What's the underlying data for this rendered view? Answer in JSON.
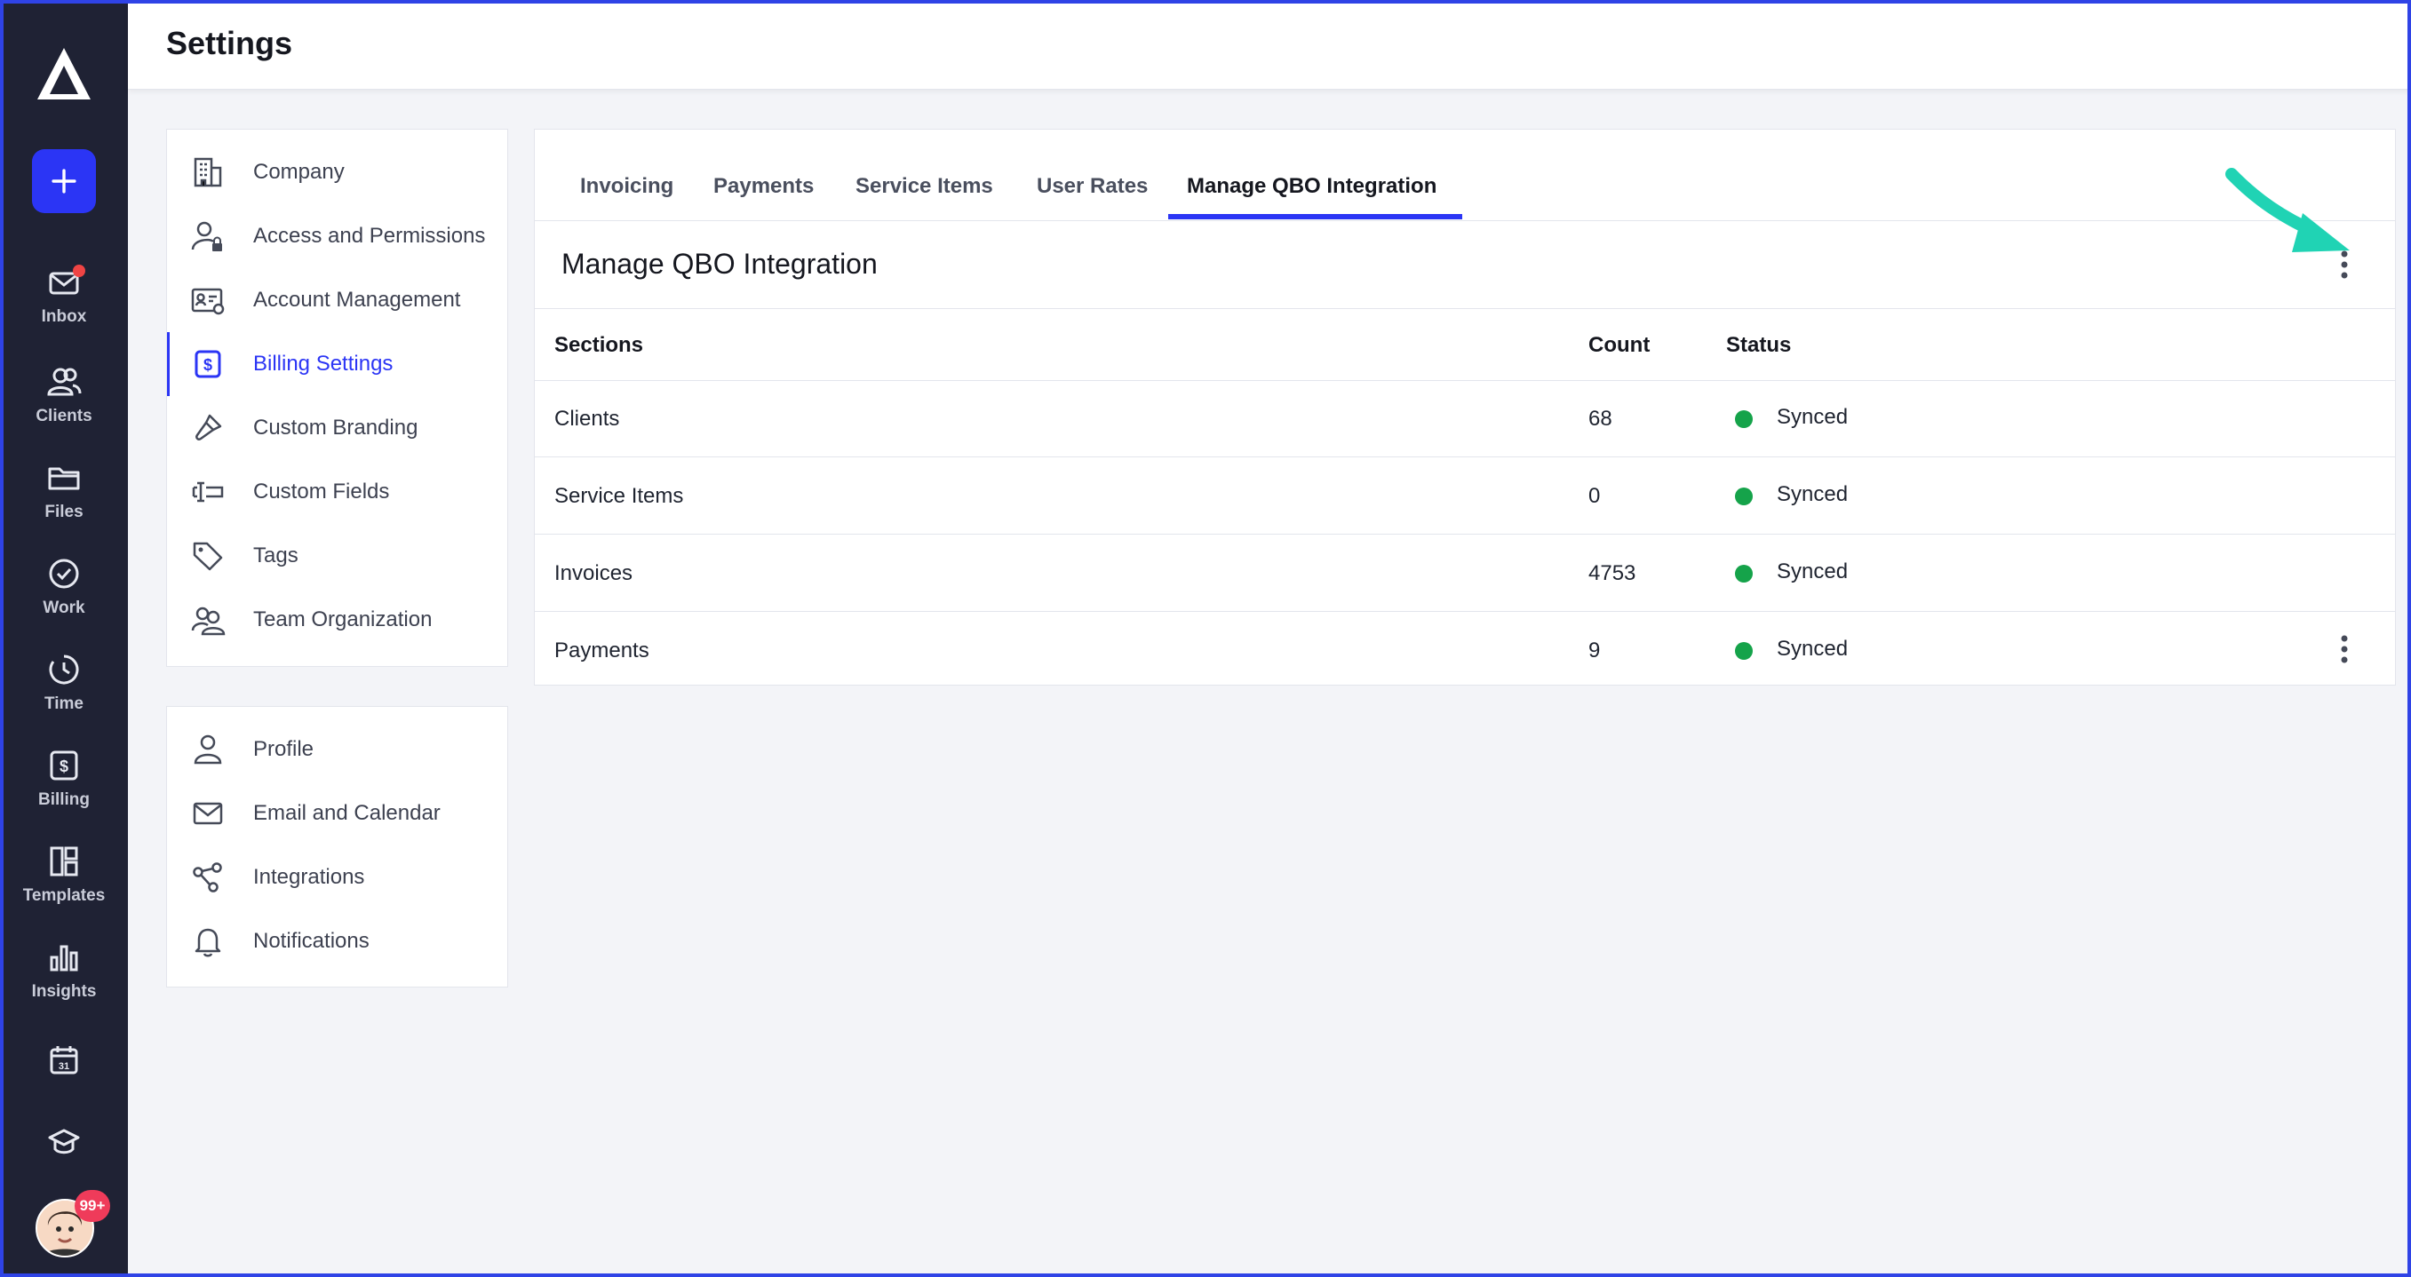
{
  "app": {
    "page_title": "Settings"
  },
  "rail": {
    "items": [
      {
        "label": "Inbox",
        "icon": "mail-icon"
      },
      {
        "label": "Clients",
        "icon": "users-icon"
      },
      {
        "label": "Files",
        "icon": "folder-icon"
      },
      {
        "label": "Work",
        "icon": "check-circle-icon"
      },
      {
        "label": "Time",
        "icon": "clock-icon"
      },
      {
        "label": "Billing",
        "icon": "dollar-square-icon"
      },
      {
        "label": "Templates",
        "icon": "templates-icon"
      },
      {
        "label": "Insights",
        "icon": "bar-chart-icon"
      }
    ],
    "avatar_badge": "99+",
    "calendar_day": "31"
  },
  "settings_nav": {
    "group1": [
      {
        "label": "Company",
        "icon": "building-icon"
      },
      {
        "label": "Access and Permissions",
        "icon": "user-lock-icon"
      },
      {
        "label": "Account Management",
        "icon": "id-card-gear-icon"
      },
      {
        "label": "Billing Settings",
        "icon": "dollar-square-icon",
        "active": true
      },
      {
        "label": "Custom Branding",
        "icon": "paint-brush-icon"
      },
      {
        "label": "Custom Fields",
        "icon": "text-field-icon"
      },
      {
        "label": "Tags",
        "icon": "tag-icon"
      },
      {
        "label": "Team Organization",
        "icon": "team-icon"
      }
    ],
    "group2": [
      {
        "label": "Profile",
        "icon": "user-icon"
      },
      {
        "label": "Email and Calendar",
        "icon": "envelope-icon"
      },
      {
        "label": "Integrations",
        "icon": "integrations-icon"
      },
      {
        "label": "Notifications",
        "icon": "bell-icon"
      }
    ]
  },
  "tabs": [
    "Invoicing",
    "Payments",
    "Service Items",
    "User Rates",
    "Manage QBO Integration"
  ],
  "active_tab": "Manage QBO Integration",
  "panel": {
    "title": "Manage QBO Integration",
    "columns": [
      "Sections",
      "Count",
      "Status"
    ],
    "rows": [
      {
        "section": "Clients",
        "count": "68",
        "status": "Synced"
      },
      {
        "section": "Service Items",
        "count": "0",
        "status": "Synced"
      },
      {
        "section": "Invoices",
        "count": "4753",
        "status": "Synced"
      },
      {
        "section": "Payments",
        "count": "9",
        "status": "Synced"
      }
    ]
  },
  "colors": {
    "accent": "#2b35f5",
    "rail_bg": "#1f2234",
    "synced": "#15a34a",
    "annotation_arrow": "#20d3b4"
  }
}
